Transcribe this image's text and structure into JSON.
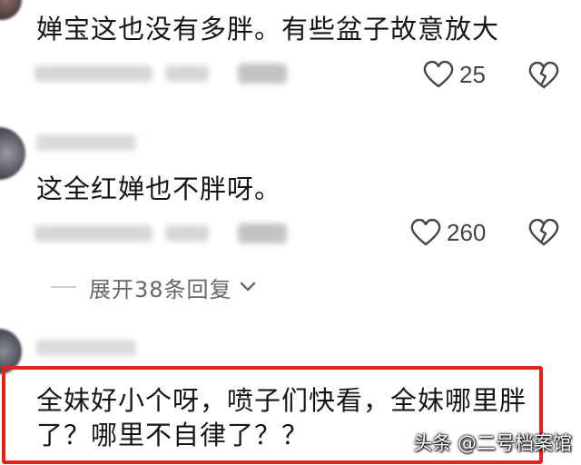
{
  "comments": [
    {
      "text": "婵宝这也没有多胖。有些盆子故意放大",
      "likes": "25"
    },
    {
      "text": "这全红婵也不胖呀。",
      "likes": "260",
      "expand_label": "展开38条回复"
    },
    {
      "text_line1": "全妹好小个呀，喷子们快看，全妹哪里胖",
      "text_line2": "了？哪里不自律了？？"
    }
  ],
  "watermark": "头条 @二号档案馆",
  "icons": {
    "like": "heart-outline-icon",
    "dislike": "broken-heart-icon",
    "expand": "chevron-down-icon"
  },
  "colors": {
    "highlight_border": "#e8201e",
    "text": "#151515",
    "meta": "#666666"
  }
}
